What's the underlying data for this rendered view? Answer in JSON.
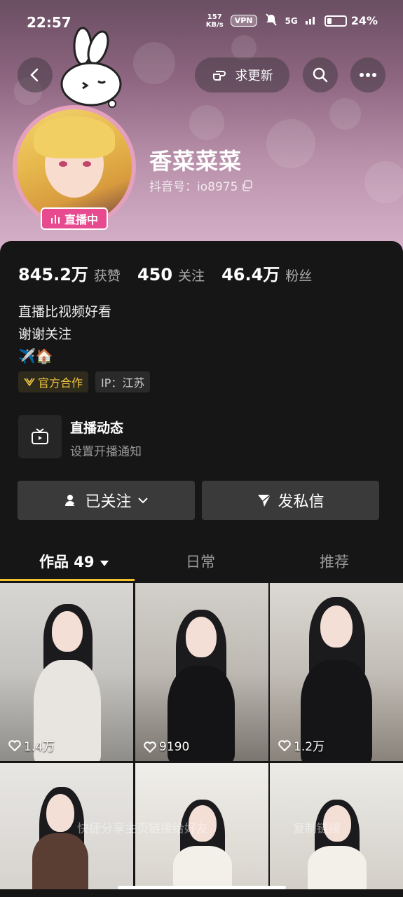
{
  "status_bar": {
    "time": "22:57",
    "net_speed_value": "157",
    "net_speed_unit": "KB/s",
    "vpn": "VPN",
    "signal": "5G",
    "battery": "24%",
    "battery_level": 0.24
  },
  "header": {
    "update_button_label": "求更新",
    "icons": [
      "back-icon",
      "hand-point-icon",
      "search-icon",
      "more-icon"
    ]
  },
  "profile": {
    "name": "香菜菜菜",
    "douyin_id": "抖音号：io8975",
    "live_badge": "直播中"
  },
  "stats": [
    {
      "value": "845.2万",
      "label": "获赞"
    },
    {
      "value": "450",
      "label": "关注"
    },
    {
      "value": "46.4万",
      "label": "粉丝"
    }
  ],
  "bio": {
    "line1": "直播比视频好看",
    "line2": "谢谢关注",
    "emojis": "✈️🏠"
  },
  "tags": {
    "official": "官方合作",
    "ip": "IP：江苏"
  },
  "live_dynamics": {
    "title": "直播动态",
    "subtitle": "设置开播通知"
  },
  "actions": {
    "follow_label": "已关注",
    "message_label": "发私信"
  },
  "tabs": [
    {
      "label": "作品 49"
    },
    {
      "label": "日常"
    },
    {
      "label": "推荐"
    }
  ],
  "videos": [
    {
      "likes": "1.4万"
    },
    {
      "likes": "9190"
    },
    {
      "likes": "1.2万"
    },
    {
      "likes": ""
    },
    {
      "likes": ""
    },
    {
      "likes": ""
    }
  ],
  "overlay": {
    "share_text": "快捷分享主页链接给好友",
    "copy_text": "复制链接"
  },
  "colors": {
    "accent_yellow": "#f2c230",
    "live_pink": "#e84a8f",
    "official_gold": "#f1c542"
  }
}
